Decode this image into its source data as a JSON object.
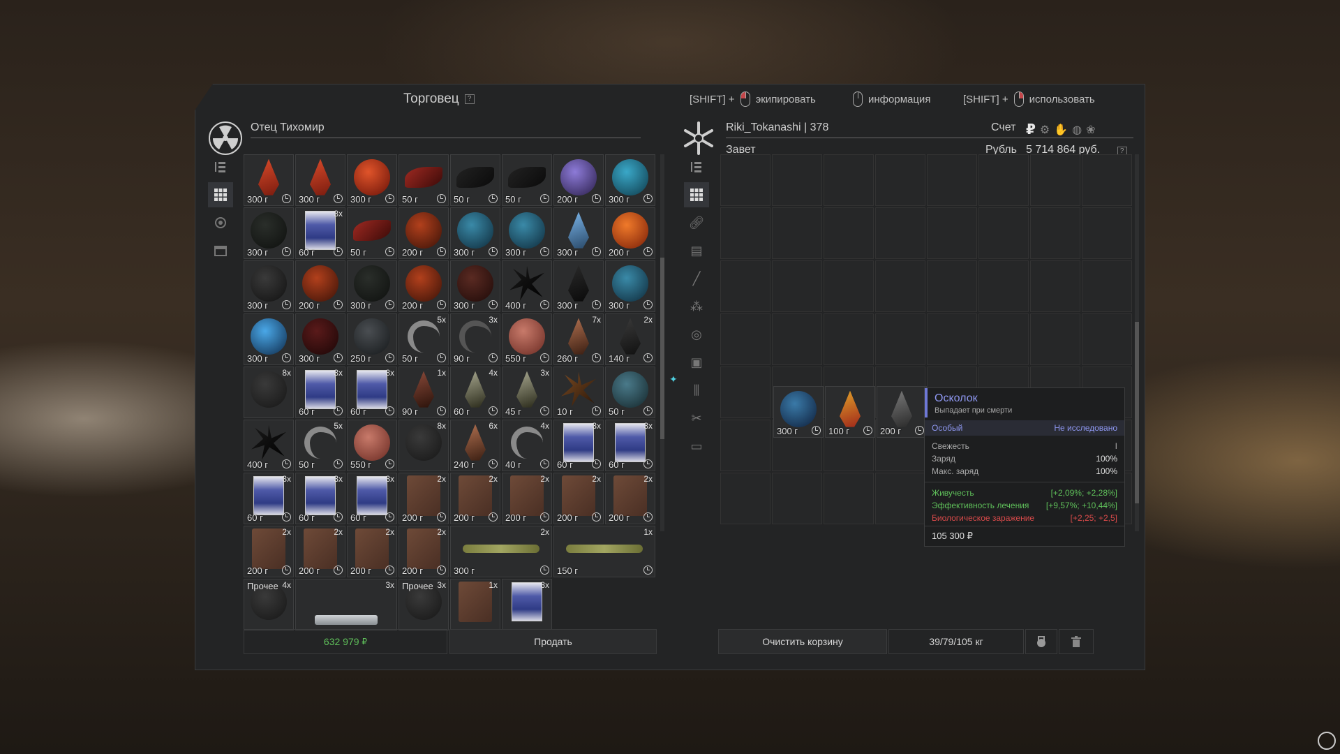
{
  "hints": [
    {
      "prefix": "[SHIFT] +",
      "mouse": "left",
      "label": "экипировать"
    },
    {
      "prefix": "",
      "mouse": "none",
      "label": "информация"
    },
    {
      "prefix": "[SHIFT] +",
      "mouse": "right",
      "label": "использовать"
    }
  ],
  "trader": {
    "title": "Торговец",
    "help": "?",
    "name": "Отец Тихомир",
    "total": "632 979",
    "currency_symbol": "₽",
    "sell_label": "Продать",
    "items": [
      {
        "art": "crystal",
        "c1": "#d84a2a",
        "c2": "#7a1c0f",
        "price": "300 г",
        "qty": "",
        "label": ""
      },
      {
        "art": "crystal",
        "c1": "#d84a2a",
        "c2": "#7a1c0f",
        "price": "300 г",
        "qty": "",
        "label": ""
      },
      {
        "art": "shape",
        "c1": "#e0542a",
        "c2": "#6a1208",
        "price": "300 г",
        "qty": "",
        "label": ""
      },
      {
        "art": "leaf",
        "c1": "#a02a22",
        "c2": "#3a0a08",
        "price": "50 г",
        "qty": "",
        "label": ""
      },
      {
        "art": "leaf",
        "c1": "#222",
        "c2": "#0a0a0a",
        "price": "50 г",
        "qty": "",
        "label": ""
      },
      {
        "art": "leaf",
        "c1": "#222",
        "c2": "#0a0a0a",
        "price": "50 г",
        "qty": "",
        "label": ""
      },
      {
        "art": "shape",
        "c1": "#8d7bd8",
        "c2": "#2a1e4a",
        "price": "200 г",
        "qty": "",
        "label": ""
      },
      {
        "art": "shape",
        "c1": "#3aa8c8",
        "c2": "#0e3a4a",
        "price": "300 г",
        "qty": "",
        "label": ""
      },
      {
        "art": "shape",
        "c1": "#2a2e2a",
        "c2": "#0e100e",
        "price": "300 г",
        "qty": "",
        "label": ""
      },
      {
        "art": "mag",
        "c1": "",
        "c2": "",
        "price": "60 г",
        "qty": "3x",
        "label": ""
      },
      {
        "art": "leaf",
        "c1": "#a02a22",
        "c2": "#3a0a08",
        "price": "50 г",
        "qty": "",
        "label": ""
      },
      {
        "art": "shape",
        "c1": "#b2401c",
        "c2": "#3a1208",
        "price": "200 г",
        "qty": "",
        "label": ""
      },
      {
        "art": "shape",
        "c1": "#3a8aa8",
        "c2": "#0e2a3a",
        "price": "300 г",
        "qty": "",
        "label": ""
      },
      {
        "art": "shape",
        "c1": "#3a8aa8",
        "c2": "#0e2a3a",
        "price": "300 г",
        "qty": "",
        "label": ""
      },
      {
        "art": "crystal",
        "c1": "#7ab4e8",
        "c2": "#2a4a6a",
        "price": "300 г",
        "qty": "",
        "label": ""
      },
      {
        "art": "shape",
        "c1": "#f07a2a",
        "c2": "#7a1e08",
        "price": "200 г",
        "qty": "",
        "label": ""
      },
      {
        "art": "shape",
        "c1": "#3a3a3a",
        "c2": "#111",
        "price": "300 г",
        "qty": "",
        "label": ""
      },
      {
        "art": "shape",
        "c1": "#b2401c",
        "c2": "#3a1208",
        "price": "200 г",
        "qty": "",
        "label": ""
      },
      {
        "art": "shape",
        "c1": "#2a2e2a",
        "c2": "#0e100e",
        "price": "300 г",
        "qty": "",
        "label": ""
      },
      {
        "art": "shape",
        "c1": "#b2401c",
        "c2": "#3a1208",
        "price": "200 г",
        "qty": "",
        "label": ""
      },
      {
        "art": "shape",
        "c1": "#5a2a22",
        "c2": "#1e0a08",
        "price": "300 г",
        "qty": "",
        "label": ""
      },
      {
        "art": "spiky",
        "c1": "#1a1a1a",
        "c2": "#000",
        "price": "400 г",
        "qty": "",
        "label": ""
      },
      {
        "art": "crystal",
        "c1": "#2a2a2a",
        "c2": "#0a0a0a",
        "price": "300 г",
        "qty": "",
        "label": ""
      },
      {
        "art": "shape",
        "c1": "#3a8aa8",
        "c2": "#0e2a3a",
        "price": "300 г",
        "qty": "",
        "label": ""
      },
      {
        "art": "shape",
        "c1": "#4aa8e8",
        "c2": "#0e2a4a",
        "price": "300 г",
        "qty": "",
        "label": ""
      },
      {
        "art": "shape",
        "c1": "#5a1a1a",
        "c2": "#1a0606",
        "price": "300 г",
        "qty": "",
        "label": ""
      },
      {
        "art": "shape",
        "c1": "#4a4e52",
        "c2": "#15181a",
        "price": "250 г",
        "qty": "",
        "label": ""
      },
      {
        "art": "horn",
        "c1": "#8a8a8a",
        "c2": "",
        "price": "50 г",
        "qty": "5x",
        "label": ""
      },
      {
        "art": "horn",
        "c1": "#555",
        "c2": "",
        "price": "90 г",
        "qty": "3x",
        "label": ""
      },
      {
        "art": "shape",
        "c1": "#c87a6a",
        "c2": "#6a2a22",
        "price": "550 г",
        "qty": "",
        "label": ""
      },
      {
        "art": "crystal",
        "c1": "#b07050",
        "c2": "#3a1e12",
        "price": "260 г",
        "qty": "7x",
        "label": ""
      },
      {
        "art": "crystal",
        "c1": "#3a3a3a",
        "c2": "#111",
        "price": "140 г",
        "qty": "2x",
        "label": ""
      },
      {
        "art": "shape",
        "c1": "#3a3a3a",
        "c2": "#161616",
        "price": "",
        "qty": "8x",
        "label": ""
      },
      {
        "art": "mag",
        "c1": "",
        "c2": "",
        "price": "60 г",
        "qty": "3x",
        "label": ""
      },
      {
        "art": "mag",
        "c1": "",
        "c2": "",
        "price": "60 г",
        "qty": "3x",
        "label": ""
      },
      {
        "art": "crystal",
        "c1": "#8a4a3a",
        "c2": "#2a120a",
        "price": "90 г",
        "qty": "1x",
        "label": ""
      },
      {
        "art": "crystal",
        "c1": "#a8a890",
        "c2": "#2a2a1a",
        "price": "60 г",
        "qty": "4x",
        "label": ""
      },
      {
        "art": "crystal",
        "c1": "#a8a890",
        "c2": "#2a2a1a",
        "price": "45 г",
        "qty": "3x",
        "label": ""
      },
      {
        "art": "spiky",
        "c1": "#7a4a22",
        "c2": "#2a1608",
        "price": "10 г",
        "qty": "",
        "label": ""
      },
      {
        "art": "shape",
        "c1": "#4a7a8a",
        "c2": "#14262a",
        "price": "50 г",
        "qty": "",
        "label": ""
      },
      {
        "art": "spiky",
        "c1": "#1a1a1a",
        "c2": "#000",
        "price": "400 г",
        "qty": "",
        "label": ""
      },
      {
        "art": "horn",
        "c1": "#8a8a8a",
        "c2": "",
        "price": "50 г",
        "qty": "5x",
        "label": ""
      },
      {
        "art": "shape",
        "c1": "#c87a6a",
        "c2": "#6a2a22",
        "price": "550 г",
        "qty": "",
        "label": ""
      },
      {
        "art": "shape",
        "c1": "#3a3a3a",
        "c2": "#161616",
        "price": "",
        "qty": "8x",
        "label": ""
      },
      {
        "art": "crystal",
        "c1": "#b07050",
        "c2": "#3a1e12",
        "price": "240 г",
        "qty": "6x",
        "label": ""
      },
      {
        "art": "horn",
        "c1": "#8a8a8a",
        "c2": "",
        "price": "40 г",
        "qty": "4x",
        "label": ""
      },
      {
        "art": "mag",
        "c1": "",
        "c2": "",
        "price": "60 г",
        "qty": "3x",
        "label": ""
      },
      {
        "art": "mag",
        "c1": "",
        "c2": "",
        "price": "60 г",
        "qty": "3x",
        "label": ""
      },
      {
        "art": "mag",
        "c1": "",
        "c2": "",
        "price": "60 г",
        "qty": "3x",
        "label": ""
      },
      {
        "art": "mag",
        "c1": "",
        "c2": "",
        "price": "60 г",
        "qty": "3x",
        "label": ""
      },
      {
        "art": "mag",
        "c1": "",
        "c2": "",
        "price": "60 г",
        "qty": "3x",
        "label": ""
      },
      {
        "art": "book",
        "c1": "",
        "c2": "",
        "price": "200 г",
        "qty": "2x",
        "label": ""
      },
      {
        "art": "book",
        "c1": "",
        "c2": "",
        "price": "200 г",
        "qty": "2x",
        "label": ""
      },
      {
        "art": "book",
        "c1": "",
        "c2": "",
        "price": "200 г",
        "qty": "2x",
        "label": ""
      },
      {
        "art": "book",
        "c1": "",
        "c2": "",
        "price": "200 г",
        "qty": "2x",
        "label": ""
      },
      {
        "art": "book",
        "c1": "",
        "c2": "",
        "price": "200 г",
        "qty": "2x",
        "label": ""
      },
      {
        "art": "book",
        "c1": "",
        "c2": "",
        "price": "200 г",
        "qty": "2x",
        "label": ""
      },
      {
        "art": "book",
        "c1": "",
        "c2": "",
        "price": "200 г",
        "qty": "2x",
        "label": ""
      },
      {
        "art": "book",
        "c1": "",
        "c2": "",
        "price": "200 г",
        "qty": "2x",
        "label": ""
      },
      {
        "art": "book",
        "c1": "",
        "c2": "",
        "price": "200 г",
        "qty": "2x",
        "label": ""
      },
      {
        "art": "bone",
        "c1": "",
        "c2": "",
        "price": "300 г",
        "qty": "2x",
        "label": "",
        "span": 2
      },
      {
        "art": "bone",
        "c1": "",
        "c2": "",
        "price": "150 г",
        "qty": "1x",
        "label": "",
        "span": 2
      },
      {
        "art": "shape",
        "c1": "#3a3a3a",
        "c2": "#161616",
        "price": "",
        "qty": "4x",
        "label": "Прочее"
      },
      {
        "art": "tray",
        "c1": "",
        "c2": "",
        "price": "",
        "qty": "3x",
        "label": "",
        "span": 2
      },
      {
        "art": "shape",
        "c1": "#3a3a3a",
        "c2": "#161616",
        "price": "",
        "qty": "3x",
        "label": "Прочее"
      },
      {
        "art": "book",
        "c1": "",
        "c2": "",
        "price": "",
        "qty": "1x",
        "label": ""
      },
      {
        "art": "mag",
        "c1": "",
        "c2": "",
        "price": "",
        "qty": "3x",
        "label": ""
      }
    ]
  },
  "player": {
    "name": "Riki_Tokanashi | 378",
    "faction": "Завет",
    "account_label": "Счет",
    "currency_name": "Рубль",
    "balance": "5 714 864 руб.",
    "help": "?",
    "cart": [
      {
        "art": "shape",
        "c1": "#3a7aa8",
        "c2": "#0e1e3a",
        "price": "300 г"
      },
      {
        "art": "crystal",
        "c1": "#e0a02a",
        "c2": "#a0281a",
        "price": "100 г"
      },
      {
        "art": "crystal",
        "c1": "#7a7a7a",
        "c2": "#2a2a2a",
        "price": "200 г"
      }
    ],
    "clear_label": "Очистить корзину",
    "weight": "39/79/105 кг"
  },
  "tooltip": {
    "title": "Осколок",
    "subtitle": "Выпадает при смерти",
    "rarity": "Особый",
    "status": "Не исследовано",
    "stats": [
      {
        "name": "Свежесть",
        "value": "I",
        "color": "#a8a8a8"
      },
      {
        "name": "Заряд",
        "value": "100%",
        "color": "#a8a8a8"
      },
      {
        "name": "Макс. заряд",
        "value": "100%",
        "color": "#a8a8a8"
      }
    ],
    "effects": [
      {
        "name": "Живучесть",
        "value": "[+2,09%; +2,28%]",
        "color": "#5fc05a"
      },
      {
        "name": "Эффективность лечения",
        "value": "[+9,57%; +10,44%]",
        "color": "#5fc05a"
      },
      {
        "name": "Биологическое заражение",
        "value": "[+2,25; +2,5]",
        "color": "#d84a4a"
      }
    ],
    "price": "105 300 ₽"
  },
  "colors": {
    "accent": "#6e78d6",
    "green": "#5fc05a",
    "red": "#d84a4a"
  }
}
